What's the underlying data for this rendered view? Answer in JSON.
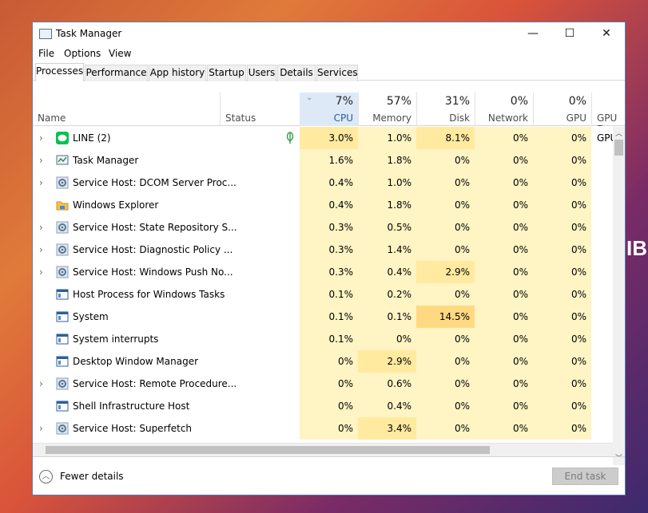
{
  "wallpaper": {
    "text": "IB"
  },
  "window": {
    "title": "Task Manager",
    "controls": {
      "minimize": "—",
      "maximize": "☐",
      "close": "✕"
    }
  },
  "menu": [
    "File",
    "Options",
    "View"
  ],
  "tabs": [
    {
      "label": "Processes",
      "active": true
    },
    {
      "label": "Performance",
      "active": false
    },
    {
      "label": "App history",
      "active": false
    },
    {
      "label": "Startup",
      "active": false
    },
    {
      "label": "Users",
      "active": false
    },
    {
      "label": "Details",
      "active": false
    },
    {
      "label": "Services",
      "active": false
    }
  ],
  "header": {
    "name": "Name",
    "status": "Status",
    "cpu": {
      "pct": "7%",
      "label": "CPU"
    },
    "memory": {
      "pct": "57%",
      "label": "Memory"
    },
    "disk": {
      "pct": "31%",
      "label": "Disk"
    },
    "network": {
      "pct": "0%",
      "label": "Network"
    },
    "gpu": {
      "pct": "0%",
      "label": "GPU"
    },
    "gpu_engine": {
      "label": "GPU En"
    }
  },
  "processes": [
    {
      "name": "LINE (2)",
      "icon": "line-app-icon",
      "expandable": true,
      "status_icon": "leaf-icon",
      "cpu": "3.0%",
      "memory": "1.0%",
      "disk": "8.1%",
      "network": "0%",
      "gpu": "0%",
      "gpu_engine": "GPU"
    },
    {
      "name": "Task Manager",
      "icon": "task-manager-icon",
      "expandable": true,
      "cpu": "1.6%",
      "memory": "1.8%",
      "disk": "0%",
      "network": "0%",
      "gpu": "0%",
      "gpu_engine": ""
    },
    {
      "name": "Service Host: DCOM Server Proc...",
      "icon": "gear-icon",
      "expandable": true,
      "cpu": "0.4%",
      "memory": "1.0%",
      "disk": "0%",
      "network": "0%",
      "gpu": "0%",
      "gpu_engine": ""
    },
    {
      "name": "Windows Explorer",
      "icon": "folder-icon",
      "expandable": false,
      "cpu": "0.4%",
      "memory": "1.8%",
      "disk": "0%",
      "network": "0%",
      "gpu": "0%",
      "gpu_engine": ""
    },
    {
      "name": "Service Host: State Repository S...",
      "icon": "gear-icon",
      "expandable": true,
      "cpu": "0.3%",
      "memory": "0.5%",
      "disk": "0%",
      "network": "0%",
      "gpu": "0%",
      "gpu_engine": ""
    },
    {
      "name": "Service Host: Diagnostic Policy ...",
      "icon": "gear-icon",
      "expandable": true,
      "cpu": "0.3%",
      "memory": "1.4%",
      "disk": "0%",
      "network": "0%",
      "gpu": "0%",
      "gpu_engine": ""
    },
    {
      "name": "Service Host: Windows Push No...",
      "icon": "gear-icon",
      "expandable": true,
      "cpu": "0.3%",
      "memory": "0.4%",
      "disk": "2.9%",
      "network": "0%",
      "gpu": "0%",
      "gpu_engine": ""
    },
    {
      "name": "Host Process for Windows Tasks",
      "icon": "window-process-icon",
      "expandable": false,
      "cpu": "0.1%",
      "memory": "0.2%",
      "disk": "0%",
      "network": "0%",
      "gpu": "0%",
      "gpu_engine": ""
    },
    {
      "name": "System",
      "icon": "window-process-icon",
      "expandable": false,
      "cpu": "0.1%",
      "memory": "0.1%",
      "disk": "14.5%",
      "network": "0%",
      "gpu": "0%",
      "gpu_engine": ""
    },
    {
      "name": "System interrupts",
      "icon": "window-process-icon",
      "expandable": false,
      "cpu": "0.1%",
      "memory": "0%",
      "disk": "0%",
      "network": "0%",
      "gpu": "0%",
      "gpu_engine": ""
    },
    {
      "name": "Desktop Window Manager",
      "icon": "window-process-icon",
      "expandable": false,
      "cpu": "0%",
      "memory": "2.9%",
      "disk": "0%",
      "network": "0%",
      "gpu": "0%",
      "gpu_engine": ""
    },
    {
      "name": "Service Host: Remote Procedure...",
      "icon": "gear-icon",
      "expandable": true,
      "cpu": "0%",
      "memory": "0.6%",
      "disk": "0%",
      "network": "0%",
      "gpu": "0%",
      "gpu_engine": ""
    },
    {
      "name": "Shell Infrastructure Host",
      "icon": "window-process-icon",
      "expandable": false,
      "cpu": "0%",
      "memory": "0.4%",
      "disk": "0%",
      "network": "0%",
      "gpu": "0%",
      "gpu_engine": ""
    },
    {
      "name": "Service Host: Superfetch",
      "icon": "gear-icon",
      "expandable": true,
      "cpu": "0%",
      "memory": "3.4%",
      "disk": "0%",
      "network": "0%",
      "gpu": "0%",
      "gpu_engine": ""
    }
  ],
  "footer": {
    "fewer_details": "Fewer details",
    "end_task": "End task"
  },
  "colors": {
    "heat_light": "#fff4c4",
    "heat_mid": "#ffeaa0",
    "heat_high": "#ffd982",
    "cpu_header": "#dde9f7",
    "window_border": "#5a7fb0"
  }
}
